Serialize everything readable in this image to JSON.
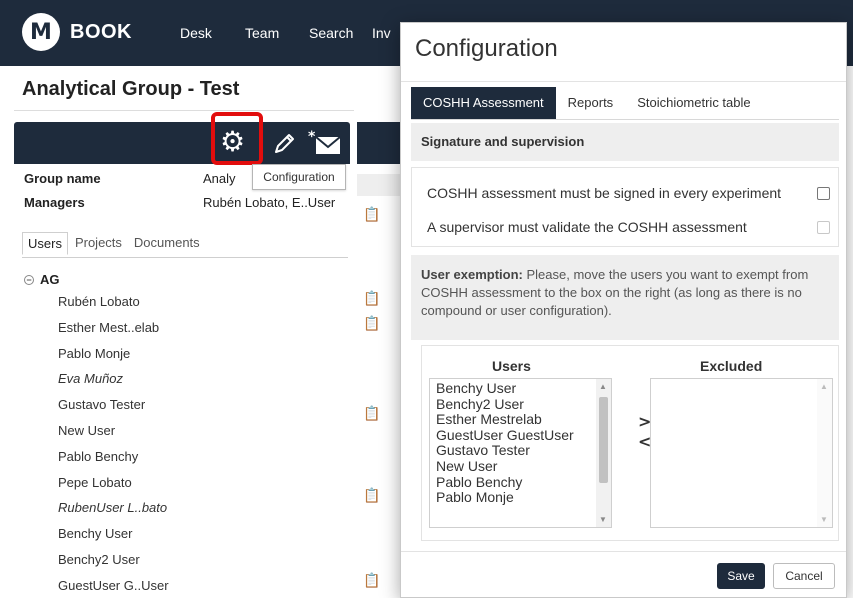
{
  "app": {
    "logo_letter": "M",
    "logo_text": "BOOK"
  },
  "nav": {
    "items": [
      "Desk",
      "Team",
      "Search",
      "Inv"
    ]
  },
  "page": {
    "title": "Analytical Group - Test"
  },
  "tooltip": "Configuration",
  "group_info": {
    "name_label": "Group name",
    "name_value": "Analy",
    "managers_label": "Managers",
    "managers_value": "Rubén Lobato, E..User"
  },
  "left_tabs": [
    "Users",
    "Projects",
    "Documents"
  ],
  "tree": {
    "group": "AG",
    "users": [
      {
        "name": "Rubén Lobato",
        "italic": false
      },
      {
        "name": "Esther Mest..elab",
        "italic": false
      },
      {
        "name": "Pablo Monje",
        "italic": false
      },
      {
        "name": "Eva Muñoz",
        "italic": true
      },
      {
        "name": "Gustavo Tester",
        "italic": false
      },
      {
        "name": "New User",
        "italic": false
      },
      {
        "name": "Pablo Benchy",
        "italic": false
      },
      {
        "name": "Pepe Lobato",
        "italic": false
      },
      {
        "name": "RubenUser L..bato",
        "italic": true
      },
      {
        "name": "Benchy User",
        "italic": false
      },
      {
        "name": "Benchy2 User",
        "italic": false
      },
      {
        "name": "GuestUser G..User",
        "italic": false
      }
    ]
  },
  "modal": {
    "title": "Configuration",
    "tabs": [
      "COSHH Assessment",
      "Reports",
      "Stoichiometric table"
    ],
    "active_tab": "COSHH Assessment",
    "section_title": "Signature and supervision",
    "options": [
      {
        "label": "COSHH assessment must be signed in every experiment",
        "checked": false,
        "disabled": false
      },
      {
        "label": "A supervisor must validate the COSHH assessment",
        "checked": false,
        "disabled": true
      }
    ],
    "exemption_bold": "User exemption:",
    "exemption_text": " Please, move the users you want to exempt from COSHH assessment to the box on the right (as long as there is no compound or user configuration).",
    "users_header": "Users",
    "excluded_header": "Excluded",
    "users_list": [
      "Benchy User",
      "Benchy2 User",
      "Esther Mestrelab",
      "GuestUser GuestUser",
      "Gustavo Tester",
      "New User",
      "Pablo Benchy",
      "Pablo Monje"
    ],
    "excluded_list": [],
    "move_right": ">",
    "move_left": "<",
    "save_label": "Save",
    "cancel_label": "Cancel"
  },
  "colors": {
    "navy": "#1e2b3c",
    "highlight": "#e20d0d",
    "band": "#eeeeee"
  },
  "icons": [
    "gear-icon",
    "pencil-icon",
    "mail-star-icon",
    "clipboard-copy-icon"
  ]
}
